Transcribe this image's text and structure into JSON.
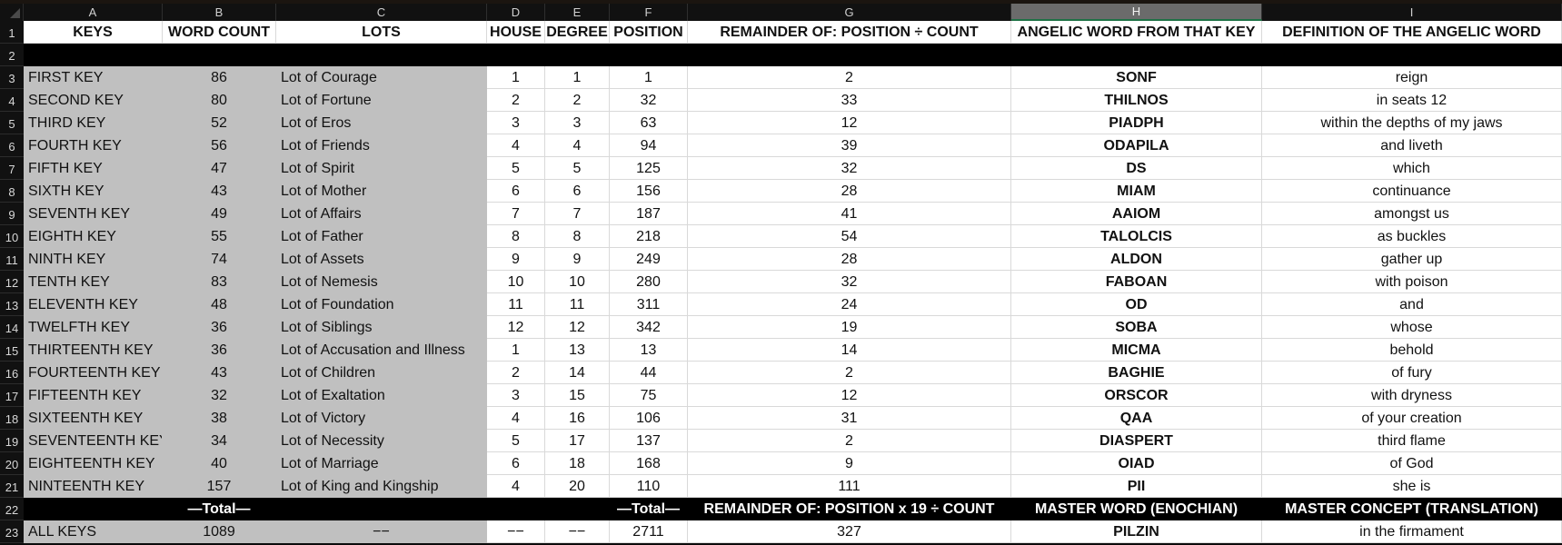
{
  "columns": [
    "A",
    "B",
    "C",
    "D",
    "E",
    "F",
    "G",
    "H",
    "I"
  ],
  "selected_column": "H",
  "row_numbers": [
    1,
    2,
    3,
    4,
    5,
    6,
    7,
    8,
    9,
    10,
    11,
    12,
    13,
    14,
    15,
    16,
    17,
    18,
    19,
    20,
    21,
    22,
    23
  ],
  "header": {
    "keys": "KEYS",
    "word_count": "WORD COUNT",
    "lots": "LOTS",
    "house": "HOUSE",
    "degree": "DEGREE",
    "position": "POSITION",
    "remainder": "REMAINDER OF: POSITION ÷ COUNT",
    "angelic_word": "ANGELIC WORD FROM THAT KEY",
    "definition": "DEFINITION OF THE ANGELIC WORD"
  },
  "rows": [
    {
      "key": "FIRST KEY",
      "count": "86",
      "lot": "Lot of Courage",
      "house": "1",
      "degree": "1",
      "position": "1",
      "remainder": "2",
      "word": "SONF",
      "definition": "reign"
    },
    {
      "key": "SECOND KEY",
      "count": "80",
      "lot": "Lot of Fortune",
      "house": "2",
      "degree": "2",
      "position": "32",
      "remainder": "33",
      "word": "THILNOS",
      "definition": "in seats 12"
    },
    {
      "key": "THIRD KEY",
      "count": "52",
      "lot": "Lot of Eros",
      "house": "3",
      "degree": "3",
      "position": "63",
      "remainder": "12",
      "word": "PIADPH",
      "definition": "within the depths of my jaws"
    },
    {
      "key": "FOURTH KEY",
      "count": "56",
      "lot": "Lot of Friends",
      "house": "4",
      "degree": "4",
      "position": "94",
      "remainder": "39",
      "word": "ODAPILA",
      "definition": "and liveth"
    },
    {
      "key": "FIFTH KEY",
      "count": "47",
      "lot": "Lot of Spirit",
      "house": "5",
      "degree": "5",
      "position": "125",
      "remainder": "32",
      "word": "DS",
      "definition": "which"
    },
    {
      "key": "SIXTH KEY",
      "count": "43",
      "lot": "Lot of Mother",
      "house": "6",
      "degree": "6",
      "position": "156",
      "remainder": "28",
      "word": "MIAM",
      "definition": "continuance"
    },
    {
      "key": "SEVENTH KEY",
      "count": "49",
      "lot": "Lot of Affairs",
      "house": "7",
      "degree": "7",
      "position": "187",
      "remainder": "41",
      "word": "AAIOM",
      "definition": "amongst us"
    },
    {
      "key": "EIGHTH KEY",
      "count": "55",
      "lot": "Lot of Father",
      "house": "8",
      "degree": "8",
      "position": "218",
      "remainder": "54",
      "word": "TALOLCIS",
      "definition": "as buckles"
    },
    {
      "key": "NINTH KEY",
      "count": "74",
      "lot": "Lot of Assets",
      "house": "9",
      "degree": "9",
      "position": "249",
      "remainder": "28",
      "word": "ALDON",
      "definition": "gather up"
    },
    {
      "key": "TENTH KEY",
      "count": "83",
      "lot": "Lot of Nemesis",
      "house": "10",
      "degree": "10",
      "position": "280",
      "remainder": "32",
      "word": "FABOAN",
      "definition": "with poison"
    },
    {
      "key": "ELEVENTH KEY",
      "count": "48",
      "lot": "Lot of Foundation",
      "house": "11",
      "degree": "11",
      "position": "311",
      "remainder": "24",
      "word": "OD",
      "definition": "and"
    },
    {
      "key": "TWELFTH KEY",
      "count": "36",
      "lot": "Lot of Siblings",
      "house": "12",
      "degree": "12",
      "position": "342",
      "remainder": "19",
      "word": "SOBA",
      "definition": "whose"
    },
    {
      "key": "THIRTEENTH KEY",
      "count": "36",
      "lot": "Lot of Accusation and Illness",
      "house": "1",
      "degree": "13",
      "position": "13",
      "remainder": "14",
      "word": "MICMA",
      "definition": "behold"
    },
    {
      "key": "FOURTEENTH KEY",
      "count": "43",
      "lot": "Lot of Children",
      "house": "2",
      "degree": "14",
      "position": "44",
      "remainder": "2",
      "word": "BAGHIE",
      "definition": "of fury"
    },
    {
      "key": "FIFTEENTH KEY",
      "count": "32",
      "lot": "Lot of Exaltation",
      "house": "3",
      "degree": "15",
      "position": "75",
      "remainder": "12",
      "word": "ORSCOR",
      "definition": "with dryness"
    },
    {
      "key": "SIXTEENTH KEY",
      "count": "38",
      "lot": "Lot of Victory",
      "house": "4",
      "degree": "16",
      "position": "106",
      "remainder": "31",
      "word": "QAA",
      "definition": "of your creation"
    },
    {
      "key": "SEVENTEENTH KEY",
      "count": "34",
      "lot": "Lot of Necessity",
      "house": "5",
      "degree": "17",
      "position": "137",
      "remainder": "2",
      "word": "DIASPERT",
      "definition": "third flame"
    },
    {
      "key": "EIGHTEENTH KEY",
      "count": "40",
      "lot": "Lot of Marriage",
      "house": "6",
      "degree": "18",
      "position": "168",
      "remainder": "9",
      "word": "OIAD",
      "definition": "of God"
    },
    {
      "key": "NINTEENTH KEY",
      "count": "157",
      "lot": "Lot of King and Kingship",
      "house": "4",
      "degree": "20",
      "position": "110",
      "remainder": "111",
      "word": "PII",
      "definition": "she is"
    }
  ],
  "total_header": {
    "count_label": "—Total—",
    "position_label": "—Total—",
    "remainder": "REMAINDER OF: POSITION x 19 ÷ COUNT",
    "master_word": "MASTER WORD (ENOCHIAN)",
    "master_concept": "MASTER CONCEPT (TRANSLATION)"
  },
  "total_row": {
    "key": "ALL KEYS",
    "count": "1089",
    "lot": "−−",
    "house": "−−",
    "degree": "−−",
    "position": "2711",
    "remainder": "327",
    "word": "PILZIN",
    "definition": "in the firmament"
  },
  "colors": {
    "gray_fill": "#c0c0c0",
    "black_band": "#000000",
    "selected_header": "#6b6b6b",
    "selection_accent": "#1e7145"
  }
}
